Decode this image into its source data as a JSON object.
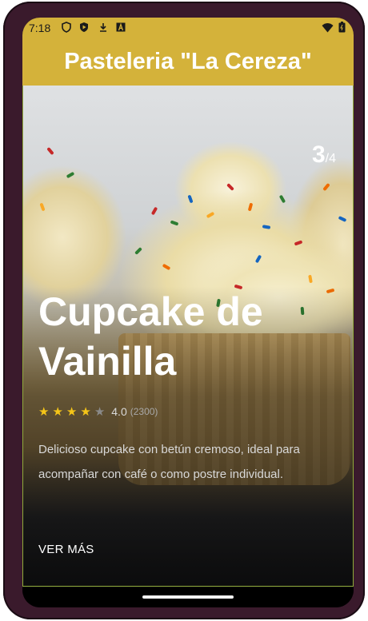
{
  "status_bar": {
    "time": "7:18",
    "left_icons": [
      "shield-icon",
      "play-protect-icon",
      "download-icon",
      "font-icon"
    ],
    "right_icons": [
      "wifi-icon",
      "battery-icon"
    ]
  },
  "app_bar": {
    "title": "Pasteleria \"La Cereza\""
  },
  "product": {
    "counter_current": "3",
    "counter_total": "/4",
    "name": "Cupcake de Vainilla",
    "rating": 4,
    "rating_max": 5,
    "rating_text": "4.0",
    "rating_count": "(2300)",
    "description": "Delicioso cupcake con betún cremoso, ideal para acompañar con café o como postre individual.",
    "more_label": "VER MÁS"
  },
  "colors": {
    "app_bar": "#d4b23a",
    "star_filled": "#f5c518",
    "star_empty": "#8a8a8a",
    "card_border": "#8faa3a"
  }
}
